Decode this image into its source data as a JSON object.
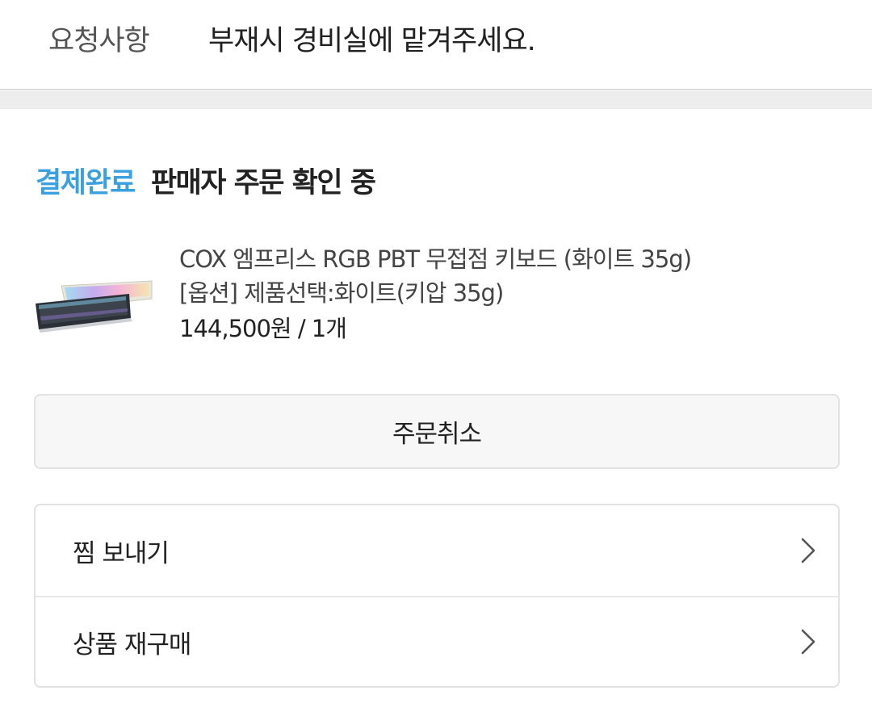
{
  "request": {
    "label": "요청사항",
    "value": "부재시 경비실에 맡겨주세요."
  },
  "order": {
    "status_badge": "결제완료",
    "status_text": "판매자 주문 확인 중",
    "status_color": "#3aa0e0"
  },
  "product": {
    "name": "COX 엠프리스 RGB PBT 무접점 키보드 (화이트 35g)",
    "option": "[옵션] 제품선택:화이트(키압 35g)",
    "price": "144,500원 / 1개",
    "thumbnail_icon": "keyboard-thumbnail"
  },
  "actions": {
    "cancel_label": "주문취소"
  },
  "menu": {
    "items": [
      {
        "label": "찜 보내기",
        "icon": "chevron-right-icon"
      },
      {
        "label": "상품 재구매",
        "icon": "chevron-right-icon"
      }
    ]
  }
}
